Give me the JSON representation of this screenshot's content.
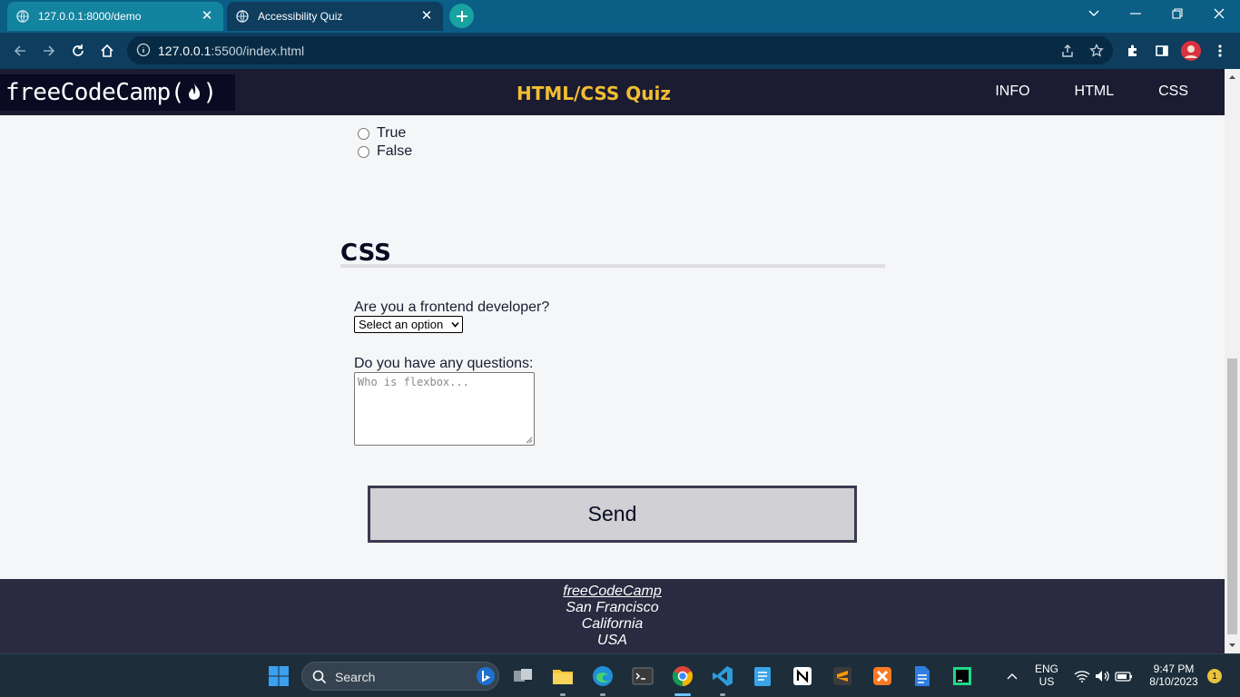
{
  "browser": {
    "tabs": [
      {
        "title": "127.0.0.1:8000/demo",
        "active": false
      },
      {
        "title": "Accessibility Quiz",
        "active": true
      }
    ],
    "url_host": "127.0.0.1",
    "url_rest": ":5500/index.html"
  },
  "site": {
    "logo_text": "freeCodeCamp",
    "title": "HTML/CSS Quiz",
    "nav": [
      "INFO",
      "HTML",
      "CSS"
    ]
  },
  "quiz": {
    "radio_options": [
      "True",
      "False"
    ],
    "section_title": "CSS",
    "frontend_question": "Are you a frontend developer?",
    "frontend_select_value": "Select an option",
    "questions_label": "Do you have any questions:",
    "questions_placeholder": "Who is flexbox...",
    "send_label": "Send"
  },
  "footer": {
    "link": "freeCodeCamp",
    "lines": [
      "San Francisco",
      "California",
      "USA"
    ]
  },
  "taskbar": {
    "search_label": "Search",
    "lang_top": "ENG",
    "lang_bottom": "US",
    "time": "9:47 PM",
    "date": "8/10/2023",
    "notification_count": "1"
  },
  "colors": {
    "header_bg": "#1b1b32",
    "title_accent": "#f1be32",
    "footer_bg": "#2a2a40",
    "button_bg": "#d0d0d5"
  }
}
